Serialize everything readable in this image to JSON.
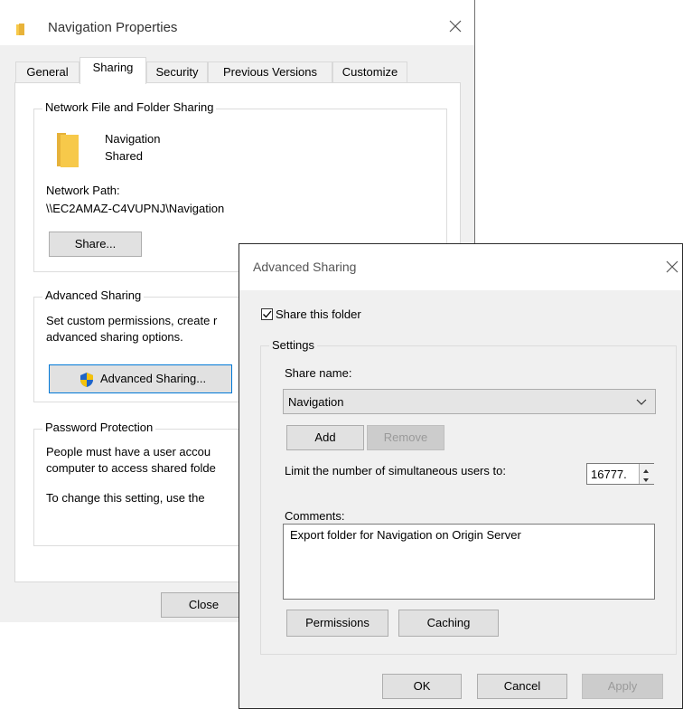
{
  "properties_window": {
    "title": "Navigation Properties",
    "tabs": [
      "General",
      "Sharing",
      "Security",
      "Previous Versions",
      "Customize"
    ],
    "network_sharing": {
      "legend": "Network File and Folder Sharing",
      "folder_name": "Navigation",
      "folder_status": "Shared",
      "network_path_label": "Network Path:",
      "network_path": "\\\\EC2AMAZ-C4VUPNJ\\Navigation",
      "share_button": "Share..."
    },
    "advanced_sharing": {
      "legend": "Advanced Sharing",
      "description_line1": "Set custom permissions, create r",
      "description_line2": "advanced sharing options.",
      "button": "Advanced Sharing..."
    },
    "password_protection": {
      "legend": "Password Protection",
      "line1": "People must have a user accou",
      "line2": "computer to access shared folde",
      "line3": "To change this setting, use the"
    },
    "close_button": "Close"
  },
  "advanced_dialog": {
    "title": "Advanced Sharing",
    "share_checkbox_label": "Share this folder",
    "share_checked": true,
    "settings_legend": "Settings",
    "share_name_label": "Share name:",
    "share_name_value": "Navigation",
    "add_button": "Add",
    "remove_button": "Remove",
    "limit_label": "Limit the number of simultaneous users to:",
    "limit_value": "16777.",
    "comments_label": "Comments:",
    "comments_value": "Export folder for Navigation on Origin Server",
    "permissions_button": "Permissions",
    "caching_button": "Caching",
    "ok_button": "OK",
    "cancel_button": "Cancel",
    "apply_button": "Apply"
  },
  "colors": {
    "folder": "#f7c94a",
    "shield_blue": "#1e64c8",
    "shield_yellow": "#f5c20b",
    "selected_border": "#0078d7"
  }
}
